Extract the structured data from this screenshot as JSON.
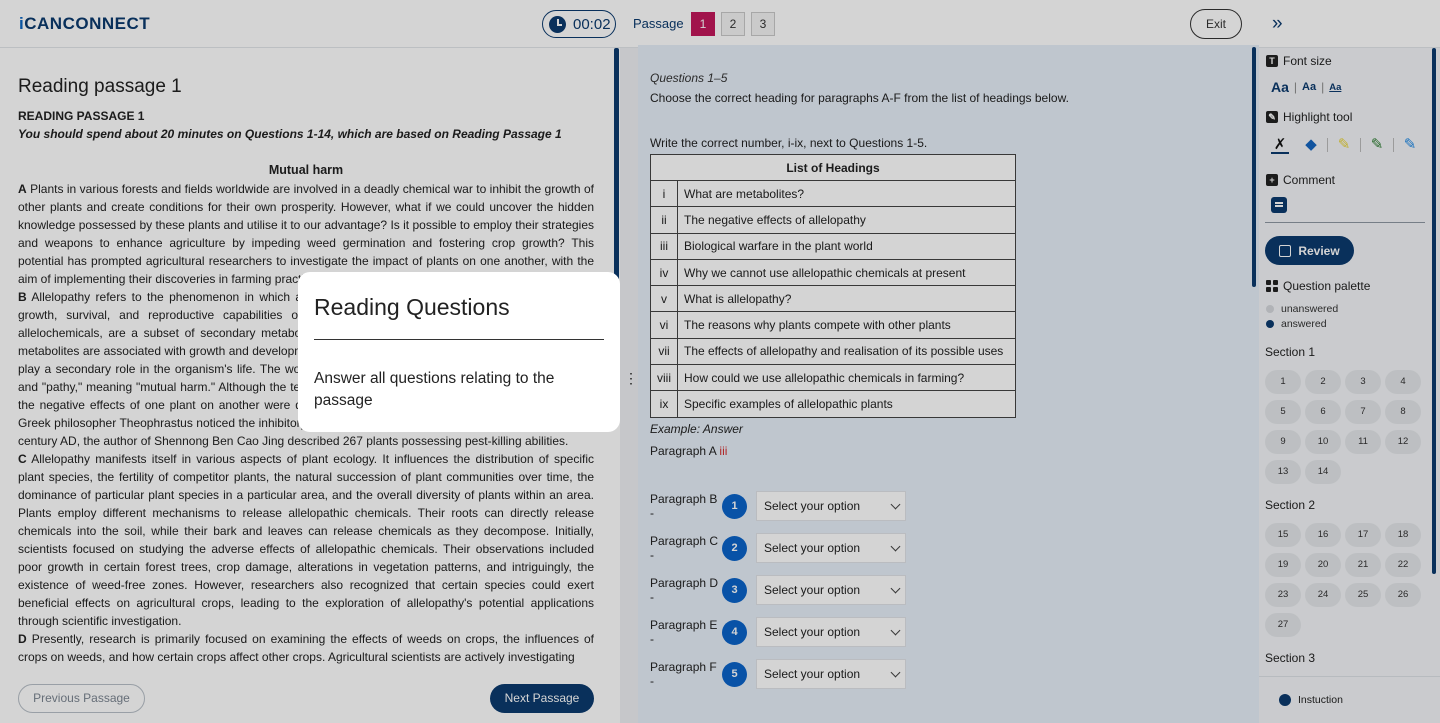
{
  "header": {
    "logo_text": "iCANCONNECT",
    "logo_i": "i",
    "logo_rest": "CANCONNECT",
    "timer": "00:02",
    "passage_label": "Passage",
    "passages": [
      "1",
      "2",
      "3"
    ],
    "active_passage": "1",
    "exit_label": "Exit",
    "collapse_icon": "»"
  },
  "left": {
    "heading": "Reading passage 1",
    "sub_heading": "READING PASSAGE 1",
    "instruction": "You should spend about 20 minutes on Questions 1-14, which are based on Reading Passage 1",
    "article_title": "Mutual harm",
    "paragraphs": [
      {
        "letter": "A",
        "text": "Plants in various forests and fields worldwide are involved in a deadly chemical war to inhibit the growth of other plants and create conditions for their own prosperity. However, what if we could uncover the hidden knowledge possessed by these plants and utilise it to our advantage? Is it possible to employ their strategies and weapons to enhance agriculture by impeding weed germination and fostering crop growth? This potential has prompted agricultural researchers to investigate the impact of plants on one another, with the aim of implementing their discoveries in farming practices."
      },
      {
        "letter": "B",
        "text": "Allelopathy refers to the phenomenon in which an organism produces biochemicals that influence the growth, survival, and reproductive capabilities of other organisms. These biochemicals, known as allelochemicals, are a subset of secondary metabolites, which are not required for metabolism. Primary metabolites are associated with growth and development, while secondary metabolites are not essential and play a secondary role in the organism's life. The word allelopathy is derived from the Greek words \"allelo\" and \"pathy,\" meaning \"mutual harm.\" Although the term allelopathy was first used by Hans Molisch in 1937, the negative effects of one plant on another were documented long before that. As early as 300 BC, the Greek philosopher Theophrastus noticed the inhibitory effects of pigweed on alfalfa. In China, during the first century AD, the author of Shennong Ben Cao Jing described 267 plants possessing pest-killing abilities."
      },
      {
        "letter": "C",
        "text": "Allelopathy manifests itself in various aspects of plant ecology. It influences the distribution of specific plant species, the fertility of competitor plants, the natural succession of plant communities over time, the dominance of particular plant species in a particular area, and the overall diversity of plants within an area. Plants employ different mechanisms to release allelopathic chemicals. Their roots can directly release chemicals into the soil, while their bark and leaves can release chemicals as they decompose. Initially, scientists focused on studying the adverse effects of allelopathic chemicals. Their observations included poor growth in certain forest trees, crop damage, alterations in vegetation patterns, and intriguingly, the existence of weed-free zones. However, researchers also recognized that certain species could exert beneficial effects on agricultural crops, leading to the exploration of allelopathy's potential applications through scientific investigation."
      },
      {
        "letter": "D",
        "text": "Presently, research is primarily focused on examining the effects of weeds on crops, the influences of crops on weeds, and how certain crops affect other crops. Agricultural scientists are actively investigating"
      }
    ],
    "prev_button": "Previous Passage",
    "next_button": "Next Passage"
  },
  "modal": {
    "title": "Reading Questions",
    "body": "Answer all questions relating to the passage"
  },
  "middle": {
    "question_range": "Questions 1–5",
    "instruction_1": "Choose the correct heading for paragraphs A-F from the list of headings below.",
    "instruction_2": "Write the correct number, i-ix, next to Questions 1-5.",
    "table_header": "List of Headings",
    "headings": [
      {
        "num": "i",
        "text": "What are metabolites?"
      },
      {
        "num": "ii",
        "text": "The negative effects of allelopathy"
      },
      {
        "num": "iii",
        "text": "Biological warfare in the plant world"
      },
      {
        "num": "iv",
        "text": "Why we cannot use allelopathic chemicals at present"
      },
      {
        "num": "v",
        "text": "What is allelopathy?"
      },
      {
        "num": "vi",
        "text": "The reasons why plants compete with other plants"
      },
      {
        "num": "vii",
        "text": "The effects of allelopathy and realisation of its possible uses"
      },
      {
        "num": "viii",
        "text": "How could we use allelopathic chemicals in farming?"
      },
      {
        "num": "ix",
        "text": "Specific examples of allelopathic plants"
      }
    ],
    "example_label": "Example: Answer",
    "example_paragraph": "Paragraph A",
    "example_answer": "iii",
    "questions": [
      {
        "label": "Paragraph B -",
        "number": "1",
        "value": "Select your option"
      },
      {
        "label": "Paragraph C -",
        "number": "2",
        "value": "Select your option"
      },
      {
        "label": "Paragraph D -",
        "number": "3",
        "value": "Select your option"
      },
      {
        "label": "Paragraph E -",
        "number": "4",
        "value": "Select your option"
      },
      {
        "label": "Paragraph F -",
        "number": "5",
        "value": "Select your option"
      }
    ]
  },
  "right": {
    "font_size_label": "Font size",
    "font_sizes": [
      "Aa",
      "Aa",
      "Aa"
    ],
    "highlight_label": "Highlight tool",
    "comment_label": "Comment",
    "review_label": "Review",
    "palette_label": "Question palette",
    "legend_unanswered": "unanswered",
    "legend_answered": "answered",
    "sections": [
      {
        "name": "Section 1",
        "questions": [
          "1",
          "2",
          "3",
          "4",
          "5",
          "6",
          "7",
          "8",
          "9",
          "10",
          "11",
          "12",
          "13",
          "14"
        ]
      },
      {
        "name": "Section 2",
        "questions": [
          "15",
          "16",
          "17",
          "18",
          "19",
          "20",
          "21",
          "22",
          "23",
          "24",
          "25",
          "26",
          "27"
        ]
      },
      {
        "name": "Section 3",
        "questions": []
      }
    ],
    "instruction_label": "Instuction"
  },
  "colors": {
    "brand": "#0b3a6e",
    "active_passage": "#c2185b",
    "badge": "#0a63c9",
    "answer_red": "#d32f2f"
  }
}
